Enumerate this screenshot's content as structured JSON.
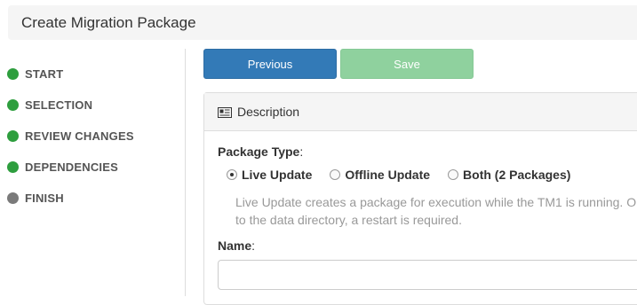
{
  "header": {
    "title": "Create Migration Package"
  },
  "steps": [
    {
      "label": "START",
      "color": "#2e9e3e"
    },
    {
      "label": "SELECTION",
      "color": "#2e9e3e"
    },
    {
      "label": "REVIEW CHANGES",
      "color": "#2e9e3e"
    },
    {
      "label": "DEPENDENCIES",
      "color": "#2e9e3e"
    },
    {
      "label": "FINISH",
      "color": "#7a7a7a"
    }
  ],
  "toolbar": {
    "previous_label": "Previous",
    "save_label": "Save",
    "save_enabled": false
  },
  "panel": {
    "icon": "newspaper-icon",
    "title": "Description"
  },
  "form": {
    "package_type_label": "Package Type",
    "package_type_options": [
      {
        "label": "Live Update",
        "selected": true
      },
      {
        "label": "Offline Update",
        "selected": false
      },
      {
        "label": "Both (2 Packages)",
        "selected": false
      }
    ],
    "help_line1": "Live Update creates a package for execution while the TM1 is running. O",
    "help_line2": "to the data directory, a restart is required.",
    "name_label": "Name",
    "name_value": "",
    "colon": ":"
  }
}
